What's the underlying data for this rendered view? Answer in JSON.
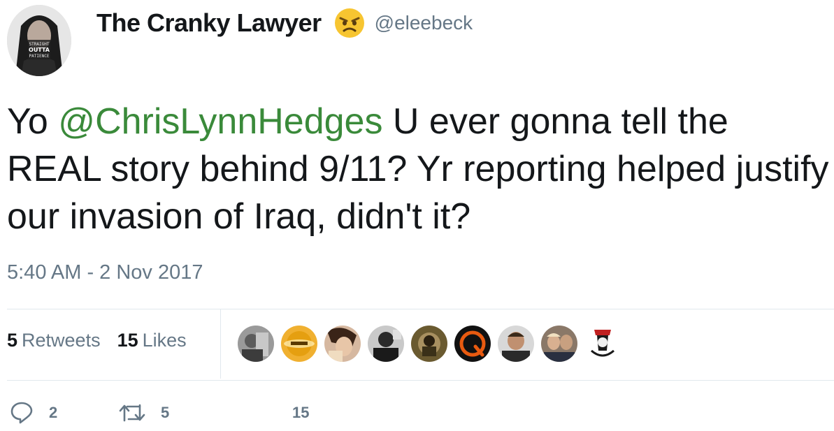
{
  "author": {
    "name": "The Cranky Lawyer",
    "handle": "@eleebeck",
    "emoji": "angry-face-emoji",
    "avatar_text": [
      "STRAIGHT",
      "OUTTA",
      "PATIENCE"
    ]
  },
  "tweet": {
    "prefix": "Yo ",
    "mention": "@ChrisLynnHedges",
    "body": " U ever gonna tell the REAL story behind 9/11? Yr reporting helped justify our invasion of Iraq, didn't it?"
  },
  "timestamp": "5:40 AM - 2 Nov 2017",
  "stats": {
    "retweets": {
      "count": "5",
      "label": "Retweets"
    },
    "likes": {
      "count": "15",
      "label": "Likes"
    }
  },
  "liker_avatars": [
    {
      "name": "liker-avatar-1",
      "color": "#8a8a8a"
    },
    {
      "name": "liker-avatar-2",
      "color": "#e0a020"
    },
    {
      "name": "liker-avatar-3",
      "color": "#c89070"
    },
    {
      "name": "liker-avatar-4",
      "color": "#3a3a3a"
    },
    {
      "name": "liker-avatar-5",
      "color": "#5a4a20"
    },
    {
      "name": "liker-avatar-6",
      "color": "#1a1a1a"
    },
    {
      "name": "liker-avatar-7",
      "color": "#606060"
    },
    {
      "name": "liker-avatar-8",
      "color": "#7a6a5a"
    },
    {
      "name": "liker-avatar-9",
      "color": "#ffffff"
    }
  ],
  "actions": {
    "reply_count": "2",
    "retweet_count": "5",
    "like_count": "15"
  },
  "colors": {
    "mention": "#3a8a3a",
    "secondary": "#657786",
    "divider": "#e1e8ed"
  }
}
